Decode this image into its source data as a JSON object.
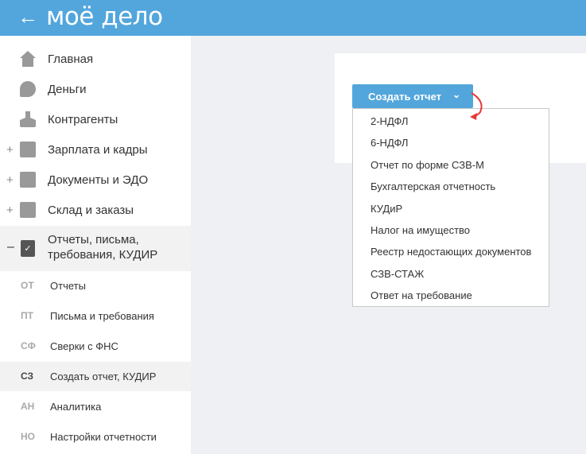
{
  "header": {
    "back_icon": "arrow-left-icon",
    "logo": "моё дело"
  },
  "sidebar": {
    "items": [
      {
        "label": "Главная",
        "icon": "home-icon",
        "expandable": false
      },
      {
        "label": "Деньги",
        "icon": "money-icon",
        "expandable": false
      },
      {
        "label": "Контрагенты",
        "icon": "person-icon",
        "expandable": false
      },
      {
        "label": "Зарплата и кадры",
        "icon": "wallet-icon",
        "expandable": true
      },
      {
        "label": "Документы и ЭДО",
        "icon": "folder-icon",
        "expandable": true
      },
      {
        "label": "Склад и заказы",
        "icon": "cart-icon",
        "expandable": true
      }
    ],
    "expanded": {
      "label_line1": "Отчеты, письма,",
      "label_line2": "требования, КУДИР",
      "toggle": "–",
      "plus": "+"
    },
    "subitems": [
      {
        "abbr": "ОТ",
        "label": "Отчеты"
      },
      {
        "abbr": "ПТ",
        "label": "Письма и требования"
      },
      {
        "abbr": "СФ",
        "label": "Сверки с ФНС"
      },
      {
        "abbr": "СЗ",
        "label": "Создать отчет, КУДИР",
        "active": true
      },
      {
        "abbr": "АН",
        "label": "Аналитика"
      },
      {
        "abbr": "НО",
        "label": "Настройки отчетности"
      }
    ]
  },
  "main": {
    "create_button": "Создать отчет",
    "menu": [
      "2-НДФЛ",
      "6-НДФЛ",
      "Отчет по форме СЗВ-М",
      "Бухгалтерская отчетность",
      "КУДиР",
      "Налог на имущество",
      "Реестр недостающих документов",
      "СЗВ-СТАЖ",
      "Ответ на требование"
    ]
  },
  "colors": {
    "brand": "#52a6dc",
    "annotation": "#e53935"
  }
}
